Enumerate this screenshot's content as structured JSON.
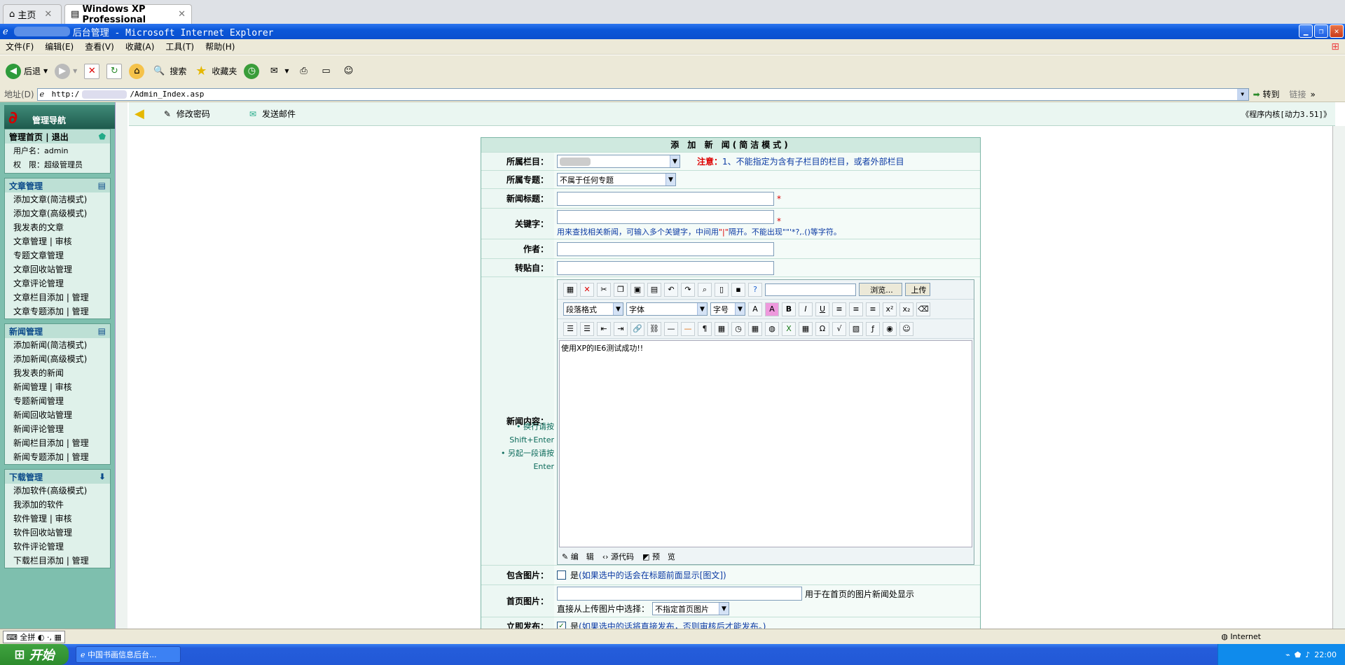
{
  "host_tabs": [
    {
      "label": "主页"
    },
    {
      "label": "Windows XP Professional"
    }
  ],
  "window": {
    "title_suffix": "后台管理 - Microsoft Internet Explorer"
  },
  "menu": [
    "文件(F)",
    "编辑(E)",
    "查看(V)",
    "收藏(A)",
    "工具(T)",
    "帮助(H)"
  ],
  "toolbar": {
    "back": "后退",
    "search": "搜索",
    "favorites": "收藏夹"
  },
  "address": {
    "label": "地址(D)",
    "url_start": "http:/",
    "url_end": "/Admin_Index.asp",
    "go": "转到",
    "links": "链接"
  },
  "left": {
    "nav_title": "管理导航",
    "top_links": {
      "home": "管理首页",
      "sep": "|",
      "logout": "退出"
    },
    "user_label": "用户名：admin",
    "role_label": "权　限：超级管理员",
    "sections": [
      {
        "title": "文章管理",
        "items": [
          "添加文章(简洁模式)",
          "添加文章(高级模式)",
          "我发表的文章",
          "文章管理 | 审核",
          "专题文章管理",
          "文章回收站管理",
          "文章评论管理",
          "文章栏目添加 | 管理",
          "文章专题添加 | 管理"
        ]
      },
      {
        "title": "新闻管理",
        "items": [
          "添加新闻(简洁模式)",
          "添加新闻(高级模式)",
          "我发表的新闻",
          "新闻管理 | 审核",
          "专题新闻管理",
          "新闻回收站管理",
          "新闻评论管理",
          "新闻栏目添加 | 管理",
          "新闻专题添加 | 管理"
        ]
      },
      {
        "title": "下载管理",
        "items": [
          "添加软件(高级模式)",
          "我添加的软件",
          "软件管理 | 审核",
          "软件回收站管理",
          "软件评论管理",
          "下载栏目添加 | 管理"
        ]
      }
    ]
  },
  "main_top": {
    "change_password": "修改密码",
    "send_mail": "发送邮件",
    "version": "《程序内核[动力3.51]》"
  },
  "form": {
    "title": "添 加 新 闻(简洁模式)",
    "column_label": "所属栏目：",
    "note_label": "注意：",
    "note_text": "1、不能指定为含有子栏目的栏目，或者外部栏目",
    "topic_label": "所属专题：",
    "topic_value": "不属于任何专题",
    "title_label": "新闻标题：",
    "keyword_label": "关键字：",
    "keyword_hint_a": "用来查找相关新闻，可输入多个关键字，中间用",
    "keyword_hint_sep": "\"|\"",
    "keyword_hint_b": "隔开。不能出现\"\"'*?,.()等字符。",
    "author_label": "作者：",
    "copyfrom_label": "转贴自：",
    "content_label": "新闻内容：",
    "tip1": "换行请按Shift+Enter",
    "tip2": "另起一段请按Enter",
    "browse": "浏览...",
    "upload": "上传",
    "para_format": "段落格式",
    "font": "字体",
    "font_size": "字号",
    "content_text": "使用XP的IE6测试成功!!",
    "tab_edit": "编　辑",
    "tab_code": "源代码",
    "tab_preview": "预　览",
    "include_pic_label": "包含图片：",
    "include_pic_text_a": "是",
    "include_pic_text_b": "(如果选中的话会在标题前面显示[图文])",
    "home_pic_label": "首页图片：",
    "home_pic_hint": "用于在首页的图片新闻处显示",
    "home_pic_select_label": "直接从上传图片中选择：",
    "home_pic_select_value": "不指定首页图片",
    "publish_label": "立即发布：",
    "publish_text_a": "是",
    "publish_text_b": "(如果选中的话将直接发布，否则审核后才能发布。)"
  },
  "status": {
    "zone": "Internet"
  },
  "taskbar": {
    "start": "开始",
    "task": "中国书画信息后台...",
    "time": "22:00"
  }
}
